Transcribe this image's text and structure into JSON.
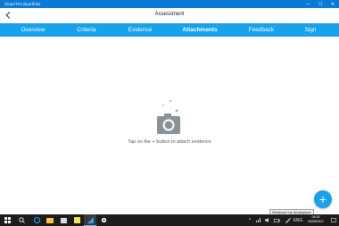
{
  "window": {
    "app_title": "Cloud Pro Eportfolio",
    "minimize_glyph": "—",
    "maximize_glyph": "☐",
    "close_glyph": "✕"
  },
  "header": {
    "title": "Assessment",
    "back_icon": "chevron-left-icon"
  },
  "tabs": [
    {
      "label": "Overview",
      "active": false
    },
    {
      "label": "Criteria",
      "active": false
    },
    {
      "label": "Evidence",
      "active": false
    },
    {
      "label": "Attachments",
      "active": true
    },
    {
      "label": "Feedback",
      "active": false
    },
    {
      "label": "Sign",
      "active": false
    }
  ],
  "empty_state": {
    "icon": "camera-icon",
    "message": "Tap on the + button to attach evidence"
  },
  "fab": {
    "label": "+",
    "icon": "plus-icon"
  },
  "tooltip": {
    "text": "Windows Ink Workspace"
  },
  "taskbar": {
    "clock_time": "08:34",
    "clock_date": "26/05/2017",
    "lang": "ENG"
  },
  "colors": {
    "titlebar": "#0a7ad6",
    "tabbar": "#1aa1ec",
    "fab": "#1aa1ec",
    "taskbar": "#1c1c1c"
  }
}
